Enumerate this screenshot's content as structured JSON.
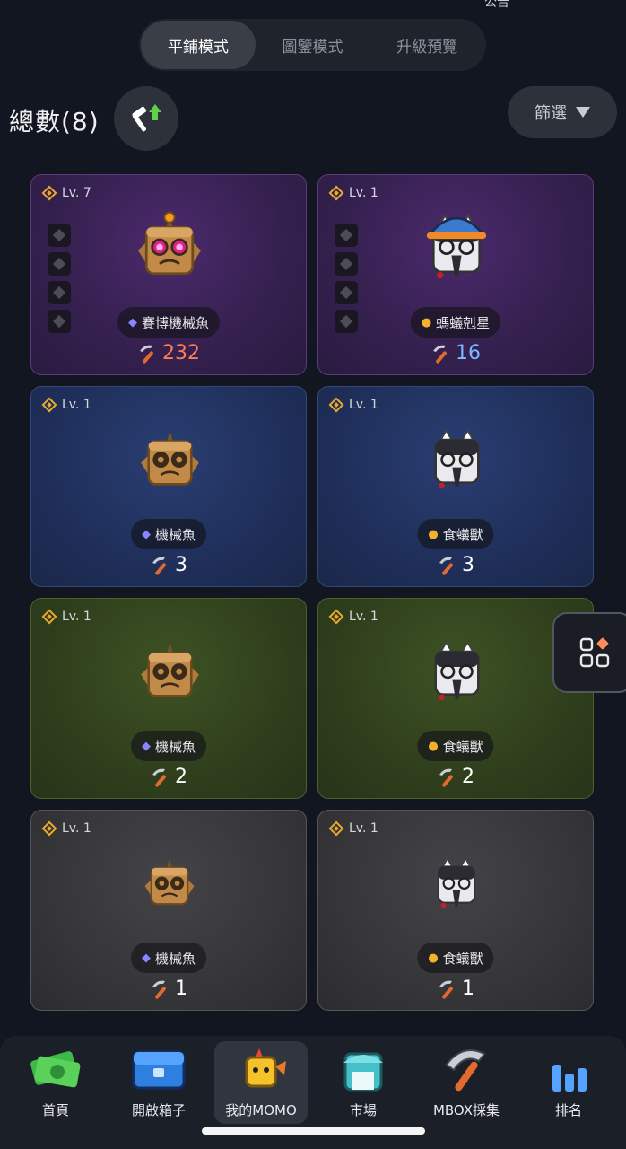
{
  "status_top": "公告",
  "mode_tabs": [
    "平鋪模式",
    "圖鑒模式",
    "升級預覽"
  ],
  "header": {
    "total": "總數(8)",
    "filter_label": "篩選"
  },
  "cards": [
    {
      "level": "Lv. 7",
      "name": "賽博機械魚",
      "power": "232",
      "power_color": "#ff7d52",
      "theme": "purple",
      "type": "fish",
      "slots": 4
    },
    {
      "level": "Lv. 1",
      "name": "螞蟻剋星",
      "power": "16",
      "power_color": "#7ab8ff",
      "theme": "purple",
      "type": "paw",
      "slots": 4
    },
    {
      "level": "Lv. 1",
      "name": "機械魚",
      "power": "3",
      "theme": "blue",
      "type": "fish",
      "slots": 0
    },
    {
      "level": "Lv. 1",
      "name": "食蟻獸",
      "power": "3",
      "theme": "blue",
      "type": "paw",
      "slots": 0
    },
    {
      "level": "Lv. 1",
      "name": "機械魚",
      "power": "2",
      "theme": "green",
      "type": "fish",
      "slots": 0
    },
    {
      "level": "Lv. 1",
      "name": "食蟻獸",
      "power": "2",
      "theme": "green",
      "type": "paw",
      "slots": 0
    },
    {
      "level": "Lv. 1",
      "name": "機械魚",
      "power": "1",
      "theme": "gray",
      "type": "fish",
      "slots": 0
    },
    {
      "level": "Lv. 1",
      "name": "食蟻獸",
      "power": "1",
      "theme": "gray",
      "type": "paw",
      "slots": 0
    }
  ],
  "nav": [
    {
      "label": "首頁",
      "icon": "money-icon"
    },
    {
      "label": "開啟箱子",
      "icon": "chest-icon"
    },
    {
      "label": "我的MOMO",
      "icon": "momo-icon",
      "active": true
    },
    {
      "label": "市場",
      "icon": "shop-icon"
    },
    {
      "label": "MBOX採集",
      "icon": "pickaxe-icon"
    },
    {
      "label": "排名",
      "icon": "ranking-icon"
    }
  ]
}
